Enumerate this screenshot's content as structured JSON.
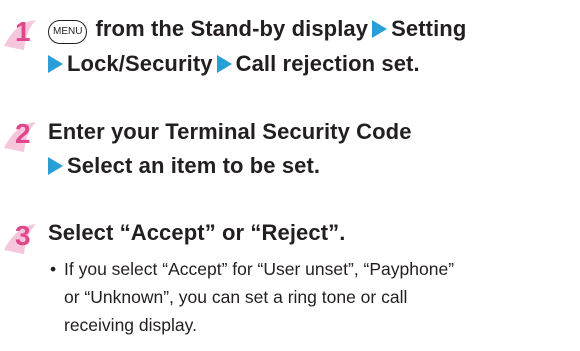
{
  "steps": [
    {
      "number": "1",
      "menu_key": "MENU",
      "line1_text": "from the Stand-by display",
      "line1_item": "Setting",
      "line2_item1": "Lock/Security",
      "line2_item2": "Call rejection set."
    },
    {
      "number": "2",
      "line1_text": "Enter your Terminal Security Code",
      "line2_item": "Select an item to be set."
    },
    {
      "number": "3",
      "line1_text": "Select “Accept” or “Reject”.",
      "note_bullet": "•",
      "note_lines": [
        "If you select “Accept” for “User unset”, “Payphone”",
        "or “Unknown”, you can set a ring tone or call",
        "receiving display."
      ]
    }
  ],
  "colors": {
    "step_number": "#e0478a",
    "step_number_swoosh": "#f6c6dc",
    "arrow": "#2a9fd6",
    "text": "#231f20"
  },
  "icons": {
    "arrow": "right-triangle-arrow-icon",
    "menu_key": "menu-key-icon"
  }
}
